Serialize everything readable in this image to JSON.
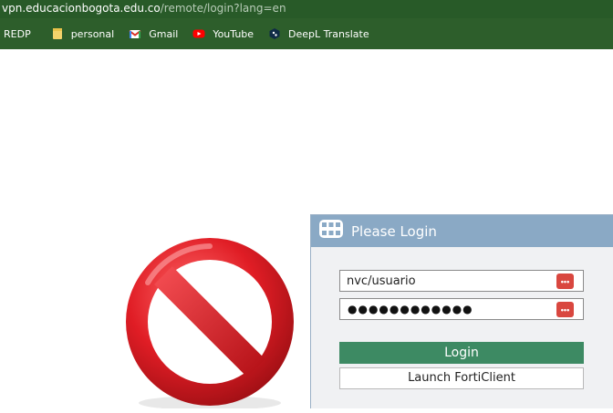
{
  "browser": {
    "url_host": "vpn.educacionbogota.edu.co",
    "url_path": "/remote/login?lang=en",
    "bookmarks": [
      {
        "label": "REDP",
        "icon": "none"
      },
      {
        "label": "personal",
        "icon": "folder-icon"
      },
      {
        "label": "Gmail",
        "icon": "gmail-icon"
      },
      {
        "label": "YouTube",
        "icon": "youtube-icon"
      },
      {
        "label": "DeepL Translate",
        "icon": "deepl-icon"
      }
    ]
  },
  "login": {
    "title": "Please Login",
    "username_value": "nvc/usuario",
    "password_mask": "●●●●●●●●●●●●",
    "kp_glyph": "•••",
    "login_label": "Login",
    "forti_label": "Launch FortiClient"
  },
  "colors": {
    "url_bar": "#285a28",
    "header": "#8aa9c5",
    "login_button": "#3d8a63",
    "no_entry": "#d8242c"
  }
}
